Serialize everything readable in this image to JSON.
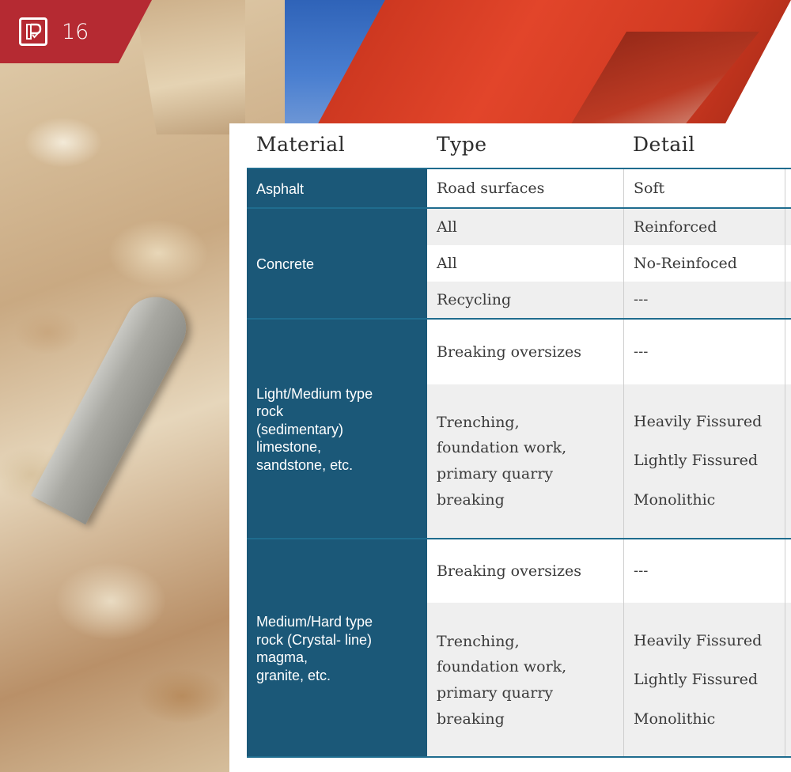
{
  "page": {
    "number": "16",
    "brand_color": "#b52a32",
    "material_color": "#1b5878",
    "logo_icon": "brand-logo-icon"
  },
  "table": {
    "headers": {
      "material": "Material",
      "type": "Type",
      "detail": "Detail"
    },
    "groups": [
      {
        "material": [
          "Asphalt"
        ],
        "rows": [
          {
            "type": [
              "Road surfaces"
            ],
            "detail": [
              "Soft"
            ]
          }
        ]
      },
      {
        "material": [
          "Concrete"
        ],
        "rows": [
          {
            "type": [
              "All"
            ],
            "detail": [
              "Reinforced"
            ]
          },
          {
            "type": [
              "All"
            ],
            "detail": [
              "No-Reinfoced"
            ]
          },
          {
            "type": [
              "Recycling"
            ],
            "detail": [
              "---"
            ]
          }
        ]
      },
      {
        "material": [
          "Light/Medium type",
          "rock",
          "(sedimentary)",
          "limestone,",
          "sandstone, etc."
        ],
        "rows": [
          {
            "type": [
              "Breaking oversizes"
            ],
            "detail": [
              "---"
            ]
          },
          {
            "type": [
              "Trenching,",
              "foundation work,",
              "primary quarry",
              "breaking"
            ],
            "detail": [
              "Heavily Fissured",
              "Lightly Fissured",
              "Monolithic"
            ]
          }
        ]
      },
      {
        "material": [
          "Medium/Hard type",
          "rock (Crystal- line)",
          "magma,",
          "granite, etc."
        ],
        "rows": [
          {
            "type": [
              "Breaking oversizes"
            ],
            "detail": [
              "---"
            ]
          },
          {
            "type": [
              "Trenching,",
              "foundation work,",
              "primary quarry",
              "breaking"
            ],
            "detail": [
              "Heavily Fissured",
              "Lightly Fissured",
              "Monolithic"
            ]
          }
        ]
      }
    ]
  }
}
